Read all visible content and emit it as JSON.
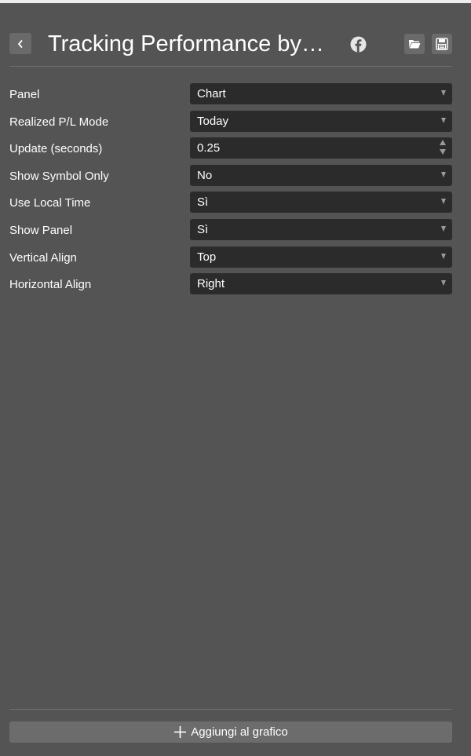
{
  "header": {
    "title": "Tracking Performance by…",
    "icons": {
      "back": "chevron-left-icon",
      "social": "facebook-icon",
      "open": "folder-open-icon",
      "save": "floppy-disk-icon"
    }
  },
  "settings": [
    {
      "label": "Panel",
      "value": "Chart",
      "control": "select"
    },
    {
      "label": "Realized P/L Mode",
      "value": "Today",
      "control": "select"
    },
    {
      "label": "Update (seconds)",
      "value": "0.25",
      "control": "number"
    },
    {
      "label": "Show Symbol Only",
      "value": "No",
      "control": "select"
    },
    {
      "label": "Use Local Time",
      "value": "Sì",
      "control": "select"
    },
    {
      "label": "Show Panel",
      "value": "Sì",
      "control": "select"
    },
    {
      "label": "Vertical Align",
      "value": "Top",
      "control": "select"
    },
    {
      "label": "Horizontal Align",
      "value": "Right",
      "control": "select"
    }
  ],
  "footer": {
    "add_label": "Aggiungi al grafico",
    "add_icon": "plus-icon"
  },
  "colors": {
    "background": "#545454",
    "field": "#2b2b2b",
    "button": "#6c6c6c",
    "text": "#ffffff"
  }
}
